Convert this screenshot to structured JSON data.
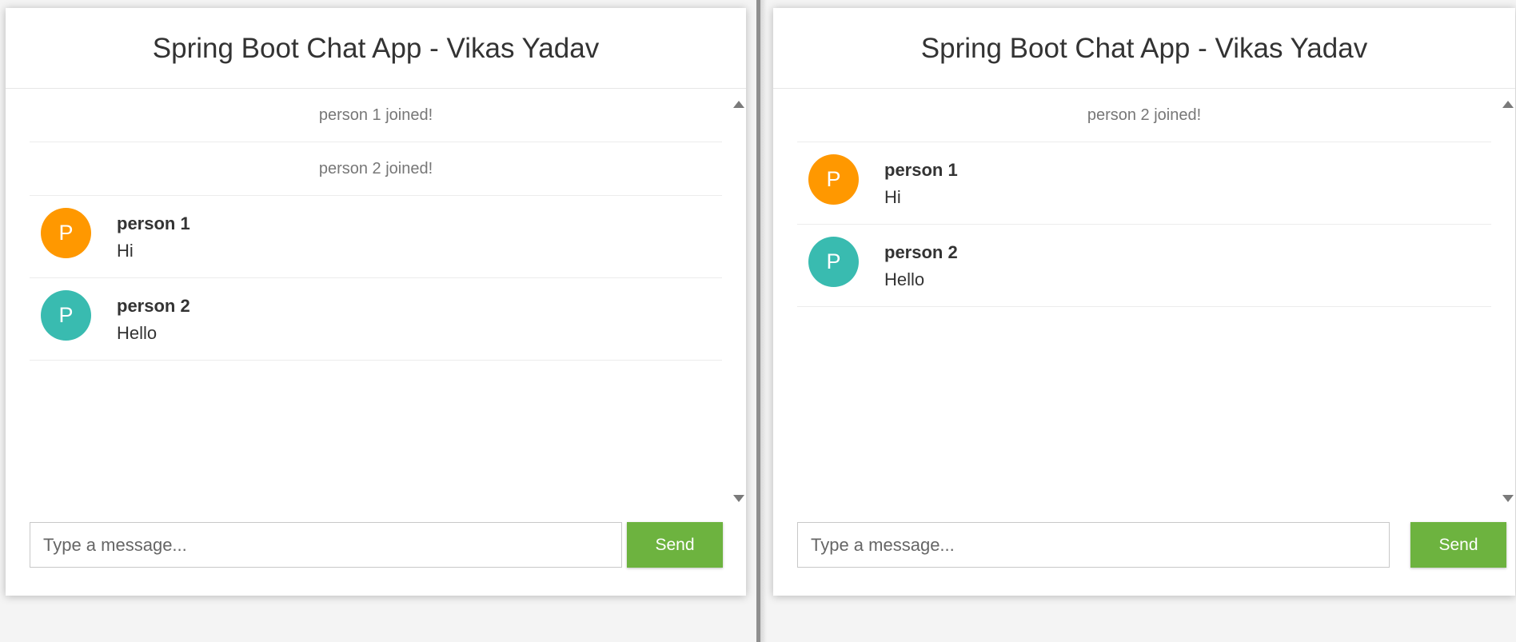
{
  "colors": {
    "accent_orange": "#ff9800",
    "accent_teal": "#39bbb0",
    "send_green": "#6db33f"
  },
  "windows": [
    {
      "title": "Spring Boot Chat App - Vikas Yadav",
      "events": [
        "person 1 joined!",
        "person 2 joined!"
      ],
      "messages": [
        {
          "avatar": "P",
          "sender": "person 1",
          "text": "Hi",
          "color": "#ff9800"
        },
        {
          "avatar": "P",
          "sender": "person 2",
          "text": "Hello",
          "color": "#39bbb0"
        }
      ],
      "input_placeholder": "Type a message...",
      "send_label": "Send"
    },
    {
      "title": "Spring Boot Chat App - Vikas Yadav",
      "events": [
        "person 2 joined!"
      ],
      "messages": [
        {
          "avatar": "P",
          "sender": "person 1",
          "text": "Hi",
          "color": "#ff9800"
        },
        {
          "avatar": "P",
          "sender": "person 2",
          "text": "Hello",
          "color": "#39bbb0"
        }
      ],
      "input_placeholder": "Type a message...",
      "send_label": "Send"
    }
  ]
}
